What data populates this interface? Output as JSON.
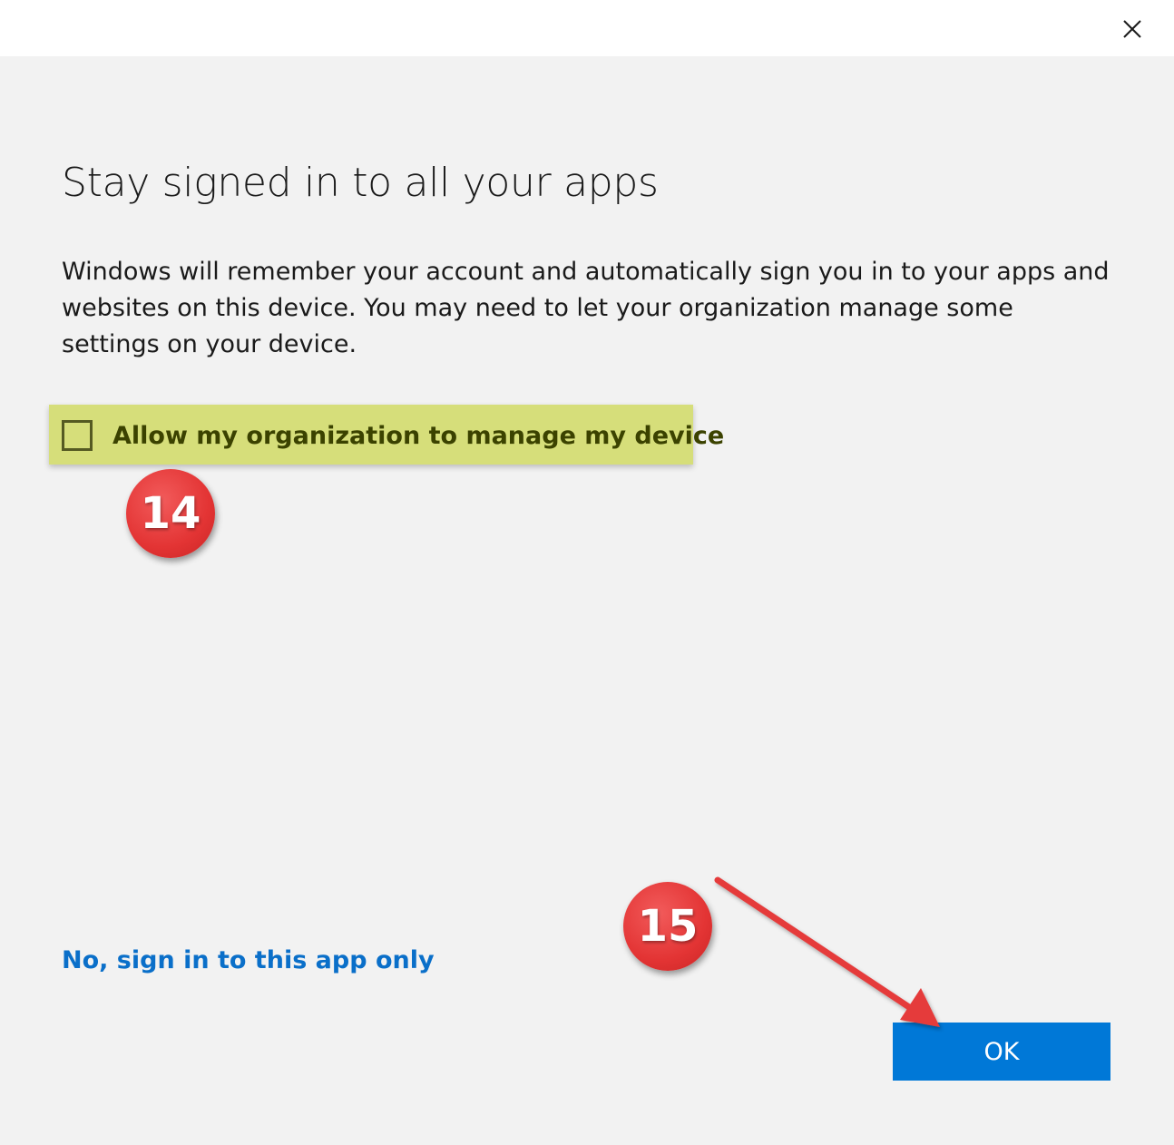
{
  "dialog": {
    "close_icon": "close-icon",
    "heading": "Stay signed in to all your apps",
    "description": "Windows will remember your account and automatically sign you in to your apps and websites on this device. You may need to let your organization manage some settings on your device.",
    "checkbox": {
      "label": "Allow my organization to manage my device",
      "checked": false
    },
    "link_label": "No, sign in to this app only",
    "ok_label": "OK"
  },
  "annotations": {
    "step_checkbox": "14",
    "step_ok": "15"
  },
  "colors": {
    "background": "#f2f2f2",
    "titlebar": "#ffffff",
    "accent": "#0078d7",
    "link": "#0a6fc9",
    "highlight": "#d6de7a",
    "badge": "#e33434",
    "arrow": "#e53b3b"
  }
}
